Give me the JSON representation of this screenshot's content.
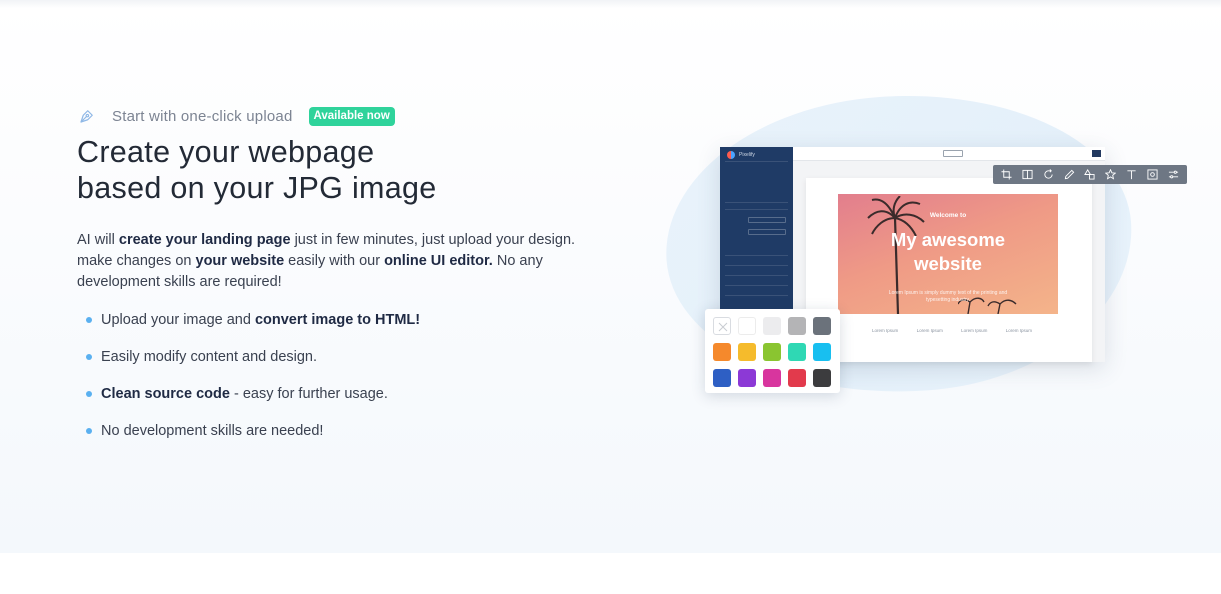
{
  "eyebrow": {
    "icon": "pen-tool-icon",
    "text": "Start with one-click upload",
    "badge": "Available now",
    "badge_color": "#2fd39b"
  },
  "headline": {
    "line1": "Create your webpage",
    "line2": "based on your JPG image"
  },
  "intro": {
    "p1": "AI will ",
    "b1": "create your landing page",
    "p2": " just in few minutes, just upload your design. make changes on ",
    "b2": "your website",
    "p3": " easily with our ",
    "b3": "online UI editor.",
    "p4": " No any development skills are required!"
  },
  "bullets": [
    {
      "pre": "Upload your image and ",
      "bold": "convert image to HTML!",
      "post": ""
    },
    {
      "pre": "Easily modify content and design.",
      "bold": "",
      "post": ""
    },
    {
      "pre": "",
      "bold": "Clean source code",
      "post": " - easy for further usage."
    },
    {
      "pre": "No development skills are needed!",
      "bold": "",
      "post": ""
    }
  ],
  "illustration": {
    "app_name": "Pixelify",
    "hero_welcome": "Welcome to",
    "hero_title_line1": "My awesome",
    "hero_title_line2": "website",
    "hero_sub": "Lorem Ipsum is simply dummy text of the printing and typesetting industry.",
    "footer_links": [
      "Lorem Ipsum",
      "Lorem Ipsum",
      "Lorem Ipsum",
      "Lorem Ipsum"
    ],
    "toolbar_icons": [
      "crop-icon",
      "split-icon",
      "rotate-icon",
      "pencil-icon",
      "shapes-icon",
      "star-icon",
      "text-icon",
      "frame-icon",
      "sliders-icon"
    ],
    "palette": [
      "none",
      "#ffffff",
      "#ececee",
      "#b4b4b6",
      "#6b727b",
      "#f5892c",
      "#f5bb2c",
      "#8ac530",
      "#2fd8b4",
      "#18bff0",
      "#2e5fc4",
      "#8c39d6",
      "#d8359e",
      "#e23a4c",
      "#3c3c3e"
    ]
  }
}
